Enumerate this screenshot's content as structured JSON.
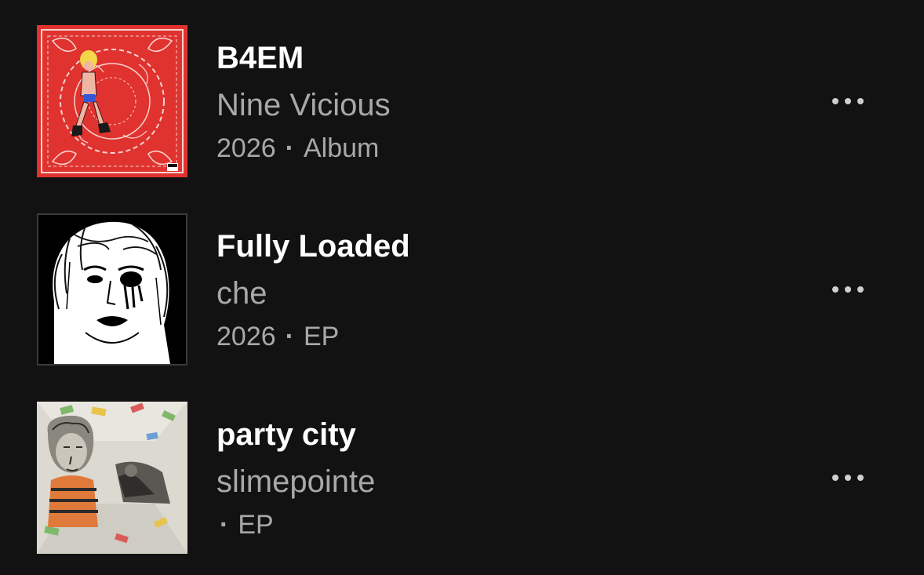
{
  "items": [
    {
      "title": "B4EM",
      "artist": "Nine Vicious",
      "year": "2026",
      "separator": "·",
      "type": "Album",
      "cover": "red-bandana-cartoon-girl-art",
      "more_icon": "more-horizontal-icon"
    },
    {
      "title": "Fully Loaded",
      "artist": "che",
      "year": "2026",
      "separator": "·",
      "type": "EP",
      "cover": "black-white-sketch-face-art",
      "more_icon": "more-horizontal-icon"
    },
    {
      "title": "party city",
      "artist": "slimepointe",
      "year": "",
      "separator": "·",
      "type": "EP",
      "cover": "pencil-sketch-money-room-art",
      "more_icon": "more-horizontal-icon"
    }
  ],
  "colors": {
    "background": "#121212",
    "title": "#ffffff",
    "subtitle": "#a8a8a8",
    "more_dots": "#cfcfcf"
  }
}
